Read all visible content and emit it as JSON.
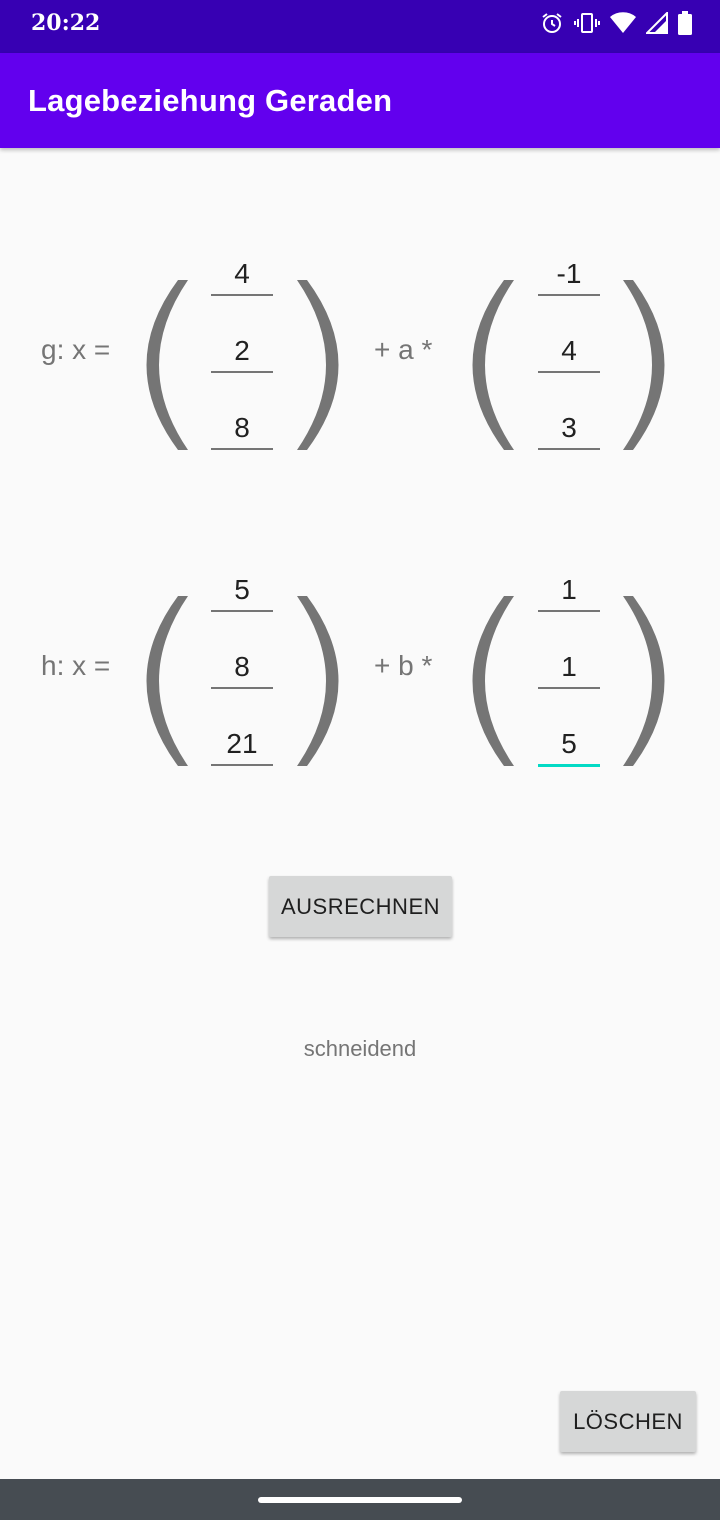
{
  "status_bar": {
    "time": "20:22",
    "icons": [
      "alarm-icon",
      "vibrate-icon",
      "wifi-icon",
      "signal-icon",
      "battery-icon"
    ]
  },
  "app_bar": {
    "title": "Lagebeziehung Geraden"
  },
  "line_g": {
    "label": "g: x =",
    "operator": "+ a *",
    "support": [
      "4",
      "2",
      "8"
    ],
    "direction": [
      "-1",
      "4",
      "3"
    ]
  },
  "line_h": {
    "label": "h: x =",
    "operator": "+ b *",
    "support": [
      "5",
      "8",
      "21"
    ],
    "direction": [
      "1",
      "1",
      "5"
    ]
  },
  "calculate_button": "AUSRECHNEN",
  "result_text": "schneidend",
  "clear_button": "LÖSCHEN",
  "colors": {
    "status_bar": "#3700b3",
    "app_bar": "#6200ee",
    "focus_accent": "#03dac5",
    "bracket": "#757575"
  }
}
